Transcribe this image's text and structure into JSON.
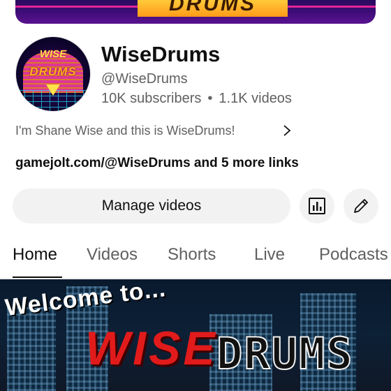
{
  "banner": {
    "logo_text": "DRUMS"
  },
  "avatar": {
    "line1": "WISE",
    "line2": "DRUMS"
  },
  "channel": {
    "name": "WiseDrums",
    "handle": "@WiseDrums",
    "subscribers": "10K subscribers",
    "separator": "•",
    "videos": "1.1K videos",
    "description": "I'm Shane Wise and this is WiseDrums!",
    "links": "gamejolt.com/@WiseDrums and 5 more links"
  },
  "actions": {
    "manage_label": "Manage videos",
    "analytics_icon": "analytics-icon",
    "edit_icon": "pencil-icon"
  },
  "tabs": [
    {
      "label": "Home",
      "active": true
    },
    {
      "label": "Videos",
      "active": false
    },
    {
      "label": "Shorts",
      "active": false
    },
    {
      "label": "Live",
      "active": false
    },
    {
      "label": "Podcasts",
      "active": false
    }
  ],
  "featured": {
    "welcome_text": "Welcome to...",
    "logo_part1": "WISE",
    "logo_part2": "DRUMS"
  }
}
